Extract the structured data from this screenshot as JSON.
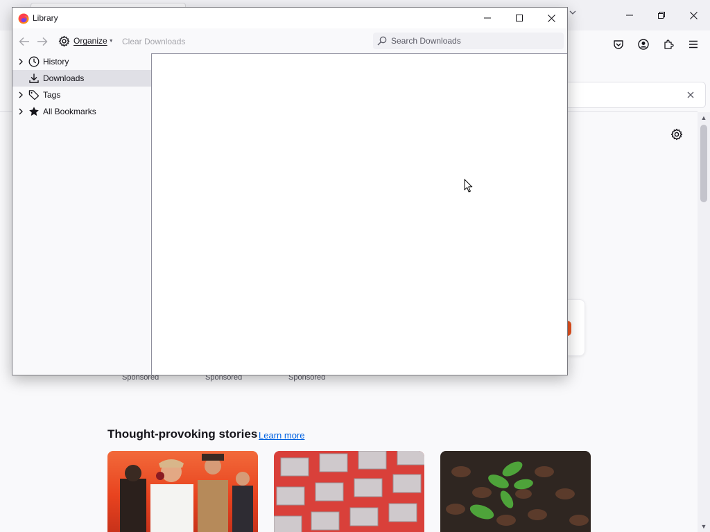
{
  "background_browser": {
    "toolbar_buttons": [
      "pocket-icon",
      "account-icon",
      "extensions-icon",
      "menu-icon"
    ],
    "window_controls": [
      "minimize-icon",
      "restore-icon",
      "close-icon"
    ],
    "sponsored_labels": [
      "Sponsored",
      "Sponsored",
      "Sponsored"
    ],
    "stories": {
      "title": "Thought-provoking stories",
      "learn_more": "Learn more"
    }
  },
  "library": {
    "title": "Library",
    "toolbar": {
      "back_icon": "back-arrow-icon",
      "forward_icon": "forward-arrow-icon",
      "organize_label": "Organize",
      "clear_downloads_label": "Clear Downloads",
      "search_placeholder": "Search Downloads",
      "search_value": ""
    },
    "sidebar": {
      "items": [
        {
          "label": "History",
          "icon": "clock-icon",
          "expandable": true,
          "selected": false
        },
        {
          "label": "Downloads",
          "icon": "download-icon",
          "expandable": false,
          "selected": true
        },
        {
          "label": "Tags",
          "icon": "tag-icon",
          "expandable": true,
          "selected": false
        },
        {
          "label": "All Bookmarks",
          "icon": "star-icon",
          "expandable": true,
          "selected": false
        }
      ]
    },
    "colors": {
      "accent": "#0061e0",
      "selected_row": "#e0e0e6",
      "sidebar_bg": "#f9f9fb"
    }
  }
}
